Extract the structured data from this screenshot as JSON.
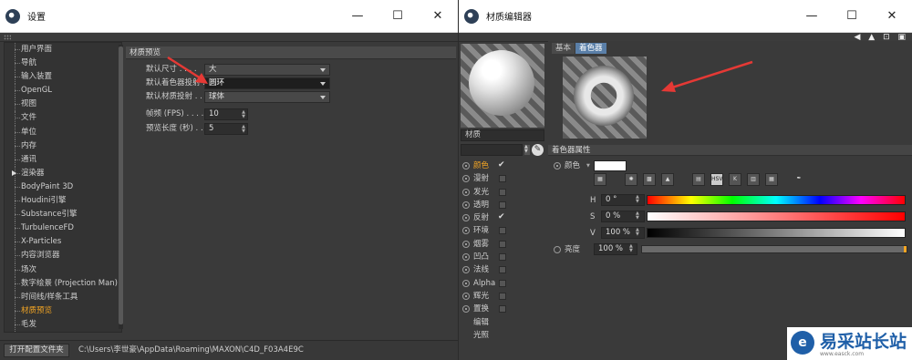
{
  "settings_window": {
    "title": "设置",
    "controls": {
      "minimize": "—",
      "maximize": "☐",
      "close": "✕"
    },
    "sidebar": {
      "items": [
        {
          "label": "用户界面"
        },
        {
          "label": "导航"
        },
        {
          "label": "输入装置"
        },
        {
          "label": "OpenGL"
        },
        {
          "label": "视图"
        },
        {
          "label": "文件"
        },
        {
          "label": "单位"
        },
        {
          "label": "内存"
        },
        {
          "label": "通讯"
        },
        {
          "label": "渲染器"
        },
        {
          "label": "BodyPaint 3D"
        },
        {
          "label": "Houdini引擎"
        },
        {
          "label": "Substance引擎"
        },
        {
          "label": "TurbulenceFD"
        },
        {
          "label": "X-Particles"
        },
        {
          "label": "内容浏览器"
        },
        {
          "label": "场次"
        },
        {
          "label": "数字绘景 (Projection Man)"
        },
        {
          "label": "时间线/样条工具"
        },
        {
          "label": "材质预览"
        },
        {
          "label": "毛发"
        }
      ],
      "active_item": "材质预览"
    },
    "section_title": "材质预览",
    "rows": [
      {
        "label": "默认尺寸 . . . .",
        "value": "大"
      },
      {
        "label": "默认着色器投射 .",
        "value": "圆环"
      },
      {
        "label": "默认材质投射 . .",
        "value": "球体"
      },
      {
        "label": "帧频 (FPS) . . . .",
        "value": "10"
      },
      {
        "label": "预览长度 (秒) . . .",
        "value": "5"
      }
    ],
    "footer": {
      "button": "打开配置文件夹",
      "path": "C:\\Users\\李世豪\\AppData\\Roaming\\MAXON\\C4D_F03A4E9C"
    }
  },
  "material_editor": {
    "title": "材质编辑器",
    "controls": {
      "minimize": "—",
      "maximize": "☐",
      "close": "✕"
    },
    "material_name": "材质",
    "channels": [
      {
        "label": "颜色",
        "checked": true,
        "active": true
      },
      {
        "label": "漫射",
        "checked": false
      },
      {
        "label": "发光",
        "checked": false
      },
      {
        "label": "透明",
        "checked": false
      },
      {
        "label": "反射",
        "checked": true
      },
      {
        "label": "环境",
        "checked": false
      },
      {
        "label": "烟雾",
        "checked": false
      },
      {
        "label": "凹凸",
        "checked": false
      },
      {
        "label": "法线",
        "checked": false
      },
      {
        "label": "Alpha",
        "checked": false
      },
      {
        "label": "辉光",
        "checked": false
      },
      {
        "label": "置换",
        "checked": false
      },
      {
        "label": "编辑"
      },
      {
        "label": "光照"
      }
    ],
    "tabs": [
      {
        "label": "基本",
        "active": false
      },
      {
        "label": "着色器",
        "active": true
      }
    ],
    "attributes_header": "着色器属性",
    "color_label": "颜色",
    "color_value": "#ffffff",
    "h": {
      "label": "H",
      "value": "0 °"
    },
    "s": {
      "label": "S",
      "value": "0 %"
    },
    "v": {
      "label": "V",
      "value": "100 %"
    },
    "brightness": {
      "label": "亮度",
      "value": "100 %"
    }
  },
  "annotation_color": "#e53935",
  "accent_color": "#f5a623",
  "watermark": {
    "name": "易采站长站",
    "url": "www.easck.com"
  }
}
